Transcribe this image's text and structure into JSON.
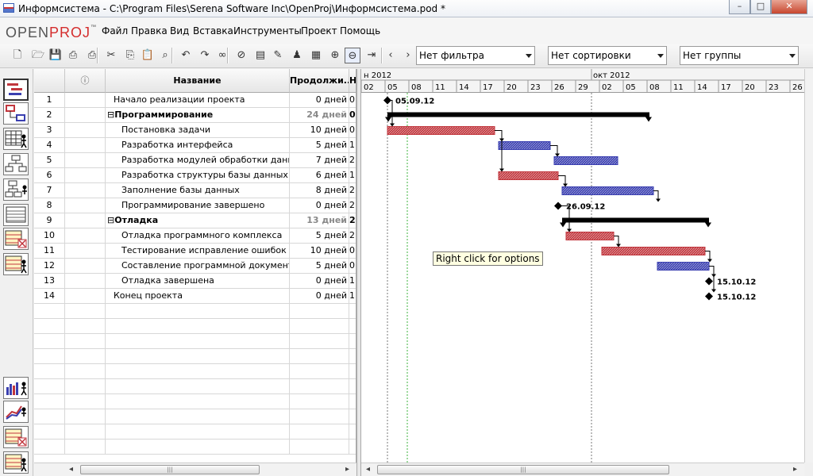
{
  "window": {
    "title": "Информсистема - C:\\Program Files\\Serena Software Inc\\OpenProj\\Информсистема.pod *",
    "buttons": {
      "minimize": "–",
      "maximize": "□",
      "close": "✕"
    }
  },
  "logo": {
    "open": "OPEN",
    "proj": "PROJ",
    "tm": "™"
  },
  "menu": [
    "Файл",
    "Правка",
    "Вид",
    "Вставка",
    "Инструменты",
    "Проект",
    "Помощь"
  ],
  "toolbar": {
    "icons": [
      "new-icon",
      "open-icon",
      "save-icon",
      "print-icon",
      "print-preview-icon",
      "cut-icon",
      "copy-icon",
      "paste-icon",
      "find-icon",
      "undo-icon",
      "redo-icon",
      "link-icon",
      "unlink-icon",
      "task-info-icon",
      "notes-icon",
      "resource-icon",
      "calendar-icon",
      "zoom-in-icon",
      "zoom-out-icon",
      "scroll-to-task-icon",
      "prev-icon",
      "next-icon"
    ],
    "filter": "Нет фильтра",
    "sort": "Нет сортировки",
    "group": "Нет группы"
  },
  "table": {
    "headers": {
      "id": "",
      "indicator": "ⓘ",
      "name": "Название",
      "duration": "Продолжи...",
      "start": "Н"
    },
    "rows": [
      {
        "id": "1",
        "name": "Начало реализации проекта",
        "duration": "0 дней",
        "start": "0",
        "summary": false,
        "indent": 1
      },
      {
        "id": "2",
        "name": "Программирование",
        "duration": "24 дней",
        "start": "0",
        "summary": true,
        "indent": 0
      },
      {
        "id": "3",
        "name": "Постановка задачи",
        "duration": "10 дней",
        "start": "0",
        "summary": false,
        "indent": 2
      },
      {
        "id": "4",
        "name": "Разработка интерфейса",
        "duration": "5 дней",
        "start": "1",
        "summary": false,
        "indent": 2
      },
      {
        "id": "5",
        "name": "Разработка модулей обработки данных",
        "duration": "7 дней",
        "start": "2",
        "summary": false,
        "indent": 2
      },
      {
        "id": "6",
        "name": "Разработка структуры  базы данных",
        "duration": "6 дней",
        "start": "1",
        "summary": false,
        "indent": 2
      },
      {
        "id": "7",
        "name": "Заполнение базы данных",
        "duration": "8 дней",
        "start": "2",
        "summary": false,
        "indent": 2
      },
      {
        "id": "8",
        "name": "Программирование завершено",
        "duration": "0 дней",
        "start": "2",
        "summary": false,
        "indent": 2
      },
      {
        "id": "9",
        "name": "Отладка",
        "duration": "13 дней",
        "start": "2",
        "summary": true,
        "indent": 0
      },
      {
        "id": "10",
        "name": "Отладка программного комплекса",
        "duration": "5 дней",
        "start": "2",
        "summary": false,
        "indent": 2
      },
      {
        "id": "11",
        "name": "Тестирование исправление ошибок",
        "duration": "10 дней",
        "start": "0",
        "summary": false,
        "indent": 2
      },
      {
        "id": "12",
        "name": "Составление программной документации",
        "duration": "5 дней",
        "start": "0",
        "summary": false,
        "indent": 2
      },
      {
        "id": "13",
        "name": "Отладка завершена",
        "duration": "0 дней",
        "start": "1",
        "summary": false,
        "indent": 2
      },
      {
        "id": "14",
        "name": "Конец проекта",
        "duration": "0 дней",
        "start": "1",
        "summary": false,
        "indent": 1
      }
    ],
    "empty_rows": 10
  },
  "gantt": {
    "months": [
      "н 2012",
      "окт 2012"
    ],
    "days": [
      "02",
      "05",
      "08",
      "11",
      "14",
      "17",
      "20",
      "23",
      "26",
      "29",
      "02",
      "05",
      "08",
      "11",
      "14",
      "17",
      "20",
      "23",
      "26"
    ],
    "timeline_start_day": 0,
    "tasks": [
      {
        "id": 1,
        "type": "milestone",
        "start": 3,
        "label": "05.09.12"
      },
      {
        "id": 2,
        "type": "summary",
        "start": 3,
        "end": 36
      },
      {
        "id": 3,
        "type": "task",
        "start": 3,
        "end": 16.5,
        "color": "red"
      },
      {
        "id": 4,
        "type": "task",
        "start": 17,
        "end": 23.5,
        "color": "blue"
      },
      {
        "id": 5,
        "type": "task",
        "start": 24,
        "end": 32,
        "color": "blue"
      },
      {
        "id": 6,
        "type": "task",
        "start": 17,
        "end": 24.5,
        "color": "red"
      },
      {
        "id": 7,
        "type": "task",
        "start": 25,
        "end": 36.5,
        "color": "blue"
      },
      {
        "id": 8,
        "type": "milestone",
        "start": 24.5,
        "label": "26.09.12"
      },
      {
        "id": 9,
        "type": "summary",
        "start": 25,
        "end": 43.5
      },
      {
        "id": 10,
        "type": "task",
        "start": 25.5,
        "end": 31.5,
        "color": "red"
      },
      {
        "id": 11,
        "type": "task",
        "start": 30,
        "end": 43,
        "color": "red"
      },
      {
        "id": 12,
        "type": "task",
        "start": 37,
        "end": 43.5,
        "color": "blue"
      },
      {
        "id": 13,
        "type": "milestone",
        "start": 43.5,
        "label": "15.10.12"
      },
      {
        "id": 14,
        "type": "milestone",
        "start": 43.5,
        "label": "15.10.12"
      }
    ],
    "colors": {
      "red": "#c1363d",
      "blue": "#3a3fb0",
      "summary": "#000000",
      "status_line": "#3cb33c"
    }
  },
  "tooltip": "Right click for options",
  "scroll": {
    "grip": "|||"
  }
}
